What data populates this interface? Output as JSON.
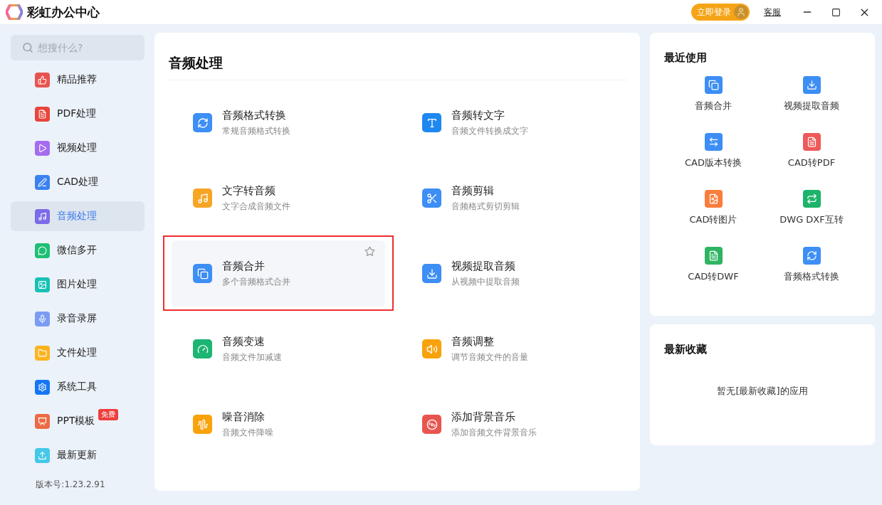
{
  "window": {
    "title": "彩虹办公中心",
    "login_button": "立即登录",
    "support_link": "客服"
  },
  "sidebar": {
    "search": {
      "placeholder": "想搜什么?"
    },
    "items": [
      {
        "label": "精品推荐",
        "selected": false,
        "color": "#e8534f"
      },
      {
        "label": "PDF处理",
        "selected": false,
        "color": "#e8453c"
      },
      {
        "label": "视频处理",
        "selected": false,
        "color": "#a56cf0"
      },
      {
        "label": "CAD处理",
        "selected": false,
        "color": "#3b82f0"
      },
      {
        "label": "音频处理",
        "selected": true,
        "color": "#7b6be6"
      },
      {
        "label": "微信多开",
        "selected": false,
        "color": "#1fbf75"
      },
      {
        "label": "图片处理",
        "selected": false,
        "color": "#17c1b5"
      },
      {
        "label": "录音录屏",
        "selected": false,
        "color": "#7a9cf2"
      },
      {
        "label": "文件处理",
        "selected": false,
        "color": "#fbb320"
      },
      {
        "label": "系统工具",
        "selected": false,
        "color": "#1677f5"
      },
      {
        "label": "PPT模板",
        "selected": false,
        "color": "#ec6a45",
        "badge": "免费"
      },
      {
        "label": "最新更新",
        "selected": false,
        "color": "#45c8e8"
      }
    ],
    "version": "版本号:1.23.2.91"
  },
  "main": {
    "title": "音频处理",
    "tools": [
      {
        "name": "音频格式转换",
        "desc": "常规音频格式转换",
        "color": "#3d8ef5",
        "highlighted": false
      },
      {
        "name": "音频转文字",
        "desc": "音频文件转换成文字",
        "color": "#1f88f0",
        "highlighted": false
      },
      {
        "name": "文字转音频",
        "desc": "文字合成音频文件",
        "color": "#f8a526",
        "highlighted": false
      },
      {
        "name": "音频剪辑",
        "desc": "音频格式剪切剪辑",
        "color": "#3d8ef5",
        "highlighted": false
      },
      {
        "name": "音频合并",
        "desc": "多个音频格式合并",
        "color": "#3d8ef5",
        "highlighted": true
      },
      {
        "name": "视频提取音频",
        "desc": "从视频中提取音频",
        "color": "#3d8ef5",
        "highlighted": false
      },
      {
        "name": "音频变速",
        "desc": "音频文件加减速",
        "color": "#1cb574",
        "highlighted": false
      },
      {
        "name": "音频调整",
        "desc": "调节音频文件的音量",
        "color": "#f9a20c",
        "highlighted": false
      },
      {
        "name": "噪音消除",
        "desc": "音频文件降噪",
        "color": "#f9a20c",
        "highlighted": false
      },
      {
        "name": "添加背景音乐",
        "desc": "添加音频文件背景音乐",
        "color": "#e8554f",
        "highlighted": false
      }
    ]
  },
  "recent": {
    "title": "最近使用",
    "items": [
      {
        "label": "音频合并",
        "color": "#3d8ef5"
      },
      {
        "label": "视频提取音频",
        "color": "#3d8ef5"
      },
      {
        "label": "CAD版本转换",
        "color": "#3d8ef5"
      },
      {
        "label": "CAD转PDF",
        "color": "#ee5a5a"
      },
      {
        "label": "CAD转图片",
        "color": "#fa7d3c"
      },
      {
        "label": "DWG DXF互转",
        "color": "#1cb36a"
      },
      {
        "label": "CAD转DWF",
        "color": "#2fb463"
      },
      {
        "label": "音频格式转换",
        "color": "#3d8ef5"
      }
    ]
  },
  "favorites": {
    "title": "最新收藏",
    "empty_text": "暂无[最新收藏]的应用"
  }
}
